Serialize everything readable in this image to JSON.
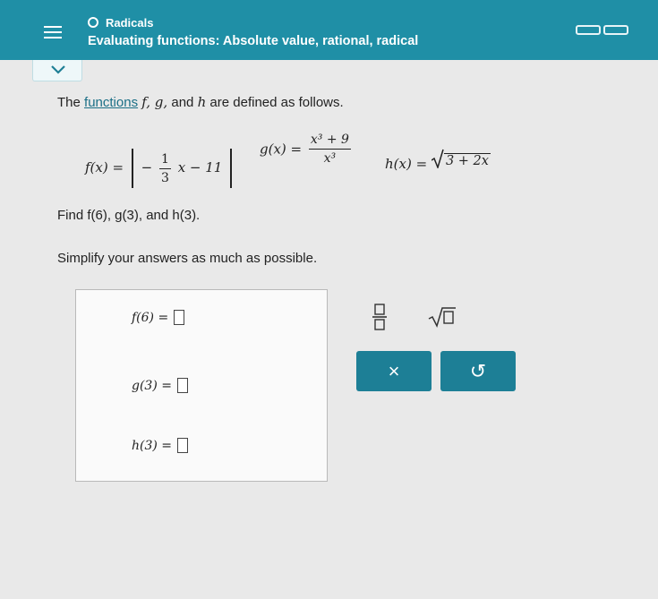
{
  "header": {
    "topic": "Radicals",
    "title": "Evaluating functions: Absolute value, rational, radical"
  },
  "problem": {
    "intro_prefix": "The",
    "functions_link": "functions",
    "intro_vars": "f, g,",
    "intro_and": "and",
    "intro_h": "h",
    "intro_suffix": "are defined as follows.",
    "f_name": "f(x) =",
    "f_minus": "−",
    "f_frac_num": "1",
    "f_frac_den": "3",
    "f_tail": "x − 11",
    "g_name": "g(x) =",
    "g_num": "x³ + 9",
    "g_den": "x³",
    "h_name": "h(x) =",
    "h_radicand": "3 + 2x",
    "find_text": "Find f(6), g(3), and h(3).",
    "simplify_text": "Simplify your answers as much as possible."
  },
  "answers": [
    {
      "label": "f(6) =",
      "value": ""
    },
    {
      "label": "g(3) =",
      "value": ""
    },
    {
      "label": "h(3) =",
      "value": ""
    }
  ],
  "tools": {
    "fraction": "fraction-tool",
    "sqrt": "sqrt-tool",
    "clear_label": "×",
    "undo_label": "↺"
  },
  "colors": {
    "header": "#1f8fa6",
    "button": "#1d7f96",
    "link": "#1b6f86"
  }
}
